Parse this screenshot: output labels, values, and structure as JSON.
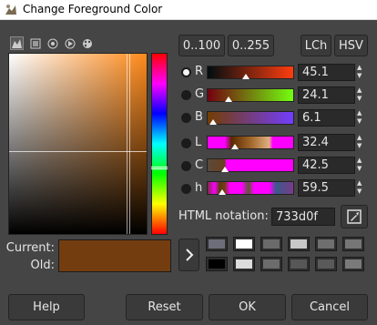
{
  "window": {
    "title": "Change Foreground Color"
  },
  "selectors": [
    {
      "name": "gimp-selector-icon"
    },
    {
      "name": "cmyk-selector-icon"
    },
    {
      "name": "watercolor-selector-icon"
    },
    {
      "name": "wheel-selector-icon"
    },
    {
      "name": "palette-selector-icon"
    }
  ],
  "range_buttons": {
    "range_100": "0..100",
    "range_255": "0..255"
  },
  "model_buttons": {
    "lch": "LCh",
    "hsv": "HSV"
  },
  "channels": [
    {
      "label": "R",
      "value": "45.1",
      "fraction": 0.451,
      "selected": true
    },
    {
      "label": "G",
      "value": "24.1",
      "fraction": 0.241,
      "selected": false
    },
    {
      "label": "B",
      "value": "6.1",
      "fraction": 0.061,
      "selected": false
    },
    {
      "label": "L",
      "value": "32.4",
      "fraction": 0.324,
      "selected": false
    },
    {
      "label": "C",
      "value": "42.5",
      "fraction": 0.2,
      "selected": false
    },
    {
      "label": "h",
      "value": "59.5",
      "fraction": 0.165,
      "selected": false
    }
  ],
  "html_notation": {
    "label": "HTML notation:",
    "value": "733d0f"
  },
  "current": {
    "current_label": "Current:",
    "old_label": "Old:",
    "color": "#733d0f"
  },
  "history": [
    "#6e6e7a",
    "#ffffff",
    "#6b6b6b",
    "#c8c8c8",
    "#6f6f6f",
    "#767676",
    "#000000",
    "#dcdcdc",
    "#6c6c6c",
    "#575757",
    "#5a5a5a",
    "#7a7a7a"
  ],
  "footer": {
    "help": "Help",
    "reset": "Reset",
    "ok": "OK",
    "cancel": "Cancel"
  },
  "colors": {
    "window_bg": "#454545",
    "accent": "#733d0f"
  }
}
